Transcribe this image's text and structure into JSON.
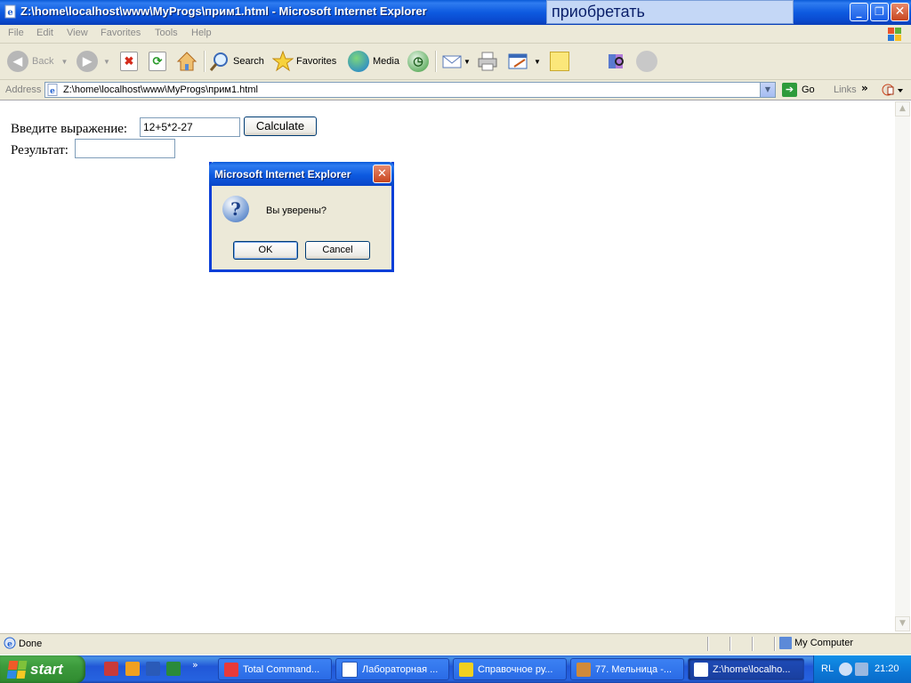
{
  "window": {
    "title": "Z:\\home\\localhost\\www\\MyProgs\\прим1.html - Microsoft Internet Explorer",
    "overlay_word": "приобретать"
  },
  "menu": [
    "File",
    "Edit",
    "View",
    "Favorites",
    "Tools",
    "Help"
  ],
  "toolbar": {
    "back": "Back",
    "search": "Search",
    "favorites": "Favorites",
    "media": "Media"
  },
  "address": {
    "label": "Address",
    "url": "Z:\\home\\localhost\\www\\MyProgs\\прим1.html",
    "go": "Go",
    "links": "Links"
  },
  "page": {
    "expression_label": "Введите выражение:",
    "expression_value": "12+5*2-27",
    "calculate_button": "Calculate",
    "result_label": "Результат:",
    "result_value": ""
  },
  "dialog": {
    "title": "Microsoft Internet Explorer",
    "message": "Вы уверены?",
    "ok": "OK",
    "cancel": "Cancel"
  },
  "status": {
    "text": "Done",
    "zone": "My Computer"
  },
  "taskbar": {
    "start": "start",
    "tasks": [
      "Total Command...",
      "Лабораторная ...",
      "Справочное ру...",
      "77. Мельница -...",
      "Z:\\home\\localho..."
    ],
    "lang": "RL",
    "clock": "21:20"
  },
  "colors": {
    "title_blue": "#0a5ad8",
    "chrome": "#ece9d8",
    "start_green": "#3c9a3c"
  }
}
